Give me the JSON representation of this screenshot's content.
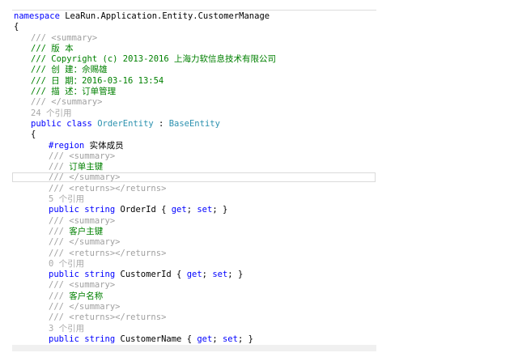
{
  "colors": {
    "keyword": "#0000ff",
    "type": "#2b91af",
    "doc_tag": "#a0a0a0",
    "comment": "#008000",
    "reference_count": "#a8a8a8",
    "text": "#000000"
  },
  "code": {
    "namespace_keyword": "namespace",
    "namespace_name": "LeaRun.Application.Entity.CustomerManage",
    "open_brace_ns": "{",
    "summary_open_1": "/// <summary>",
    "version": "/// 版 本",
    "copyright": "/// Copyright (c) 2013-2016 上海力软信息技术有限公司",
    "creator": "/// 创 建：佘赐雄",
    "date": "/// 日 期：2016-03-16 13:54",
    "description": "/// 描 述：订单管理",
    "summary_close_1": "/// </summary>",
    "class_refs": "24 个引用",
    "class_modifiers": "public class",
    "class_name": "OrderEntity",
    "class_colon": " : ",
    "base_class": "BaseEntity",
    "open_brace_class": "{",
    "region_keyword": "#region",
    "region_name": " 实体成员",
    "members": [
      {
        "summary_open": "/// <summary>",
        "doc_prefix": "/// ",
        "doc_text": "订单主键",
        "summary_close": "/// </summary>",
        "returns": "/// <returns></returns>",
        "refs": "5 个引用",
        "modifiers": "public string",
        "name": " OrderId { ",
        "get": "get",
        "sep": "; ",
        "set": "set",
        "end": "; }"
      },
      {
        "summary_open": "/// <summary>",
        "doc_prefix": "/// ",
        "doc_text": "客户主键",
        "summary_close": "/// </summary>",
        "returns": "/// <returns></returns>",
        "refs": "0 个引用",
        "modifiers": "public string",
        "name": " CustomerId { ",
        "get": "get",
        "sep": "; ",
        "set": "set",
        "end": "; }"
      },
      {
        "summary_open": "/// <summary>",
        "doc_prefix": "/// ",
        "doc_text": "客户名称",
        "summary_close": "/// </summary>",
        "returns": "/// <returns></returns>",
        "refs": "3 个引用",
        "modifiers": "public string",
        "name": " CustomerName { ",
        "get": "get",
        "sep": "; ",
        "set": "set",
        "end": "; }"
      }
    ]
  }
}
